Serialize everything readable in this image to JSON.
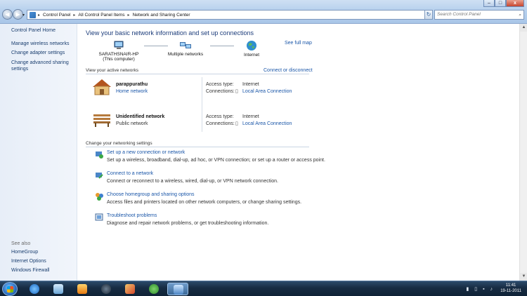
{
  "window": {
    "minimize_label": "–",
    "maximize_label": "□",
    "close_label": "x"
  },
  "address": {
    "crumbs": [
      "Control Panel",
      "All Control Panel Items",
      "Network and Sharing Center"
    ],
    "search_placeholder": "Search Control Panel"
  },
  "sidebar": {
    "home": "Control Panel Home",
    "links": [
      "Manage wireless networks",
      "Change adapter settings",
      "Change advanced sharing settings"
    ],
    "see_also_label": "See also",
    "see_also": [
      "HomeGroup",
      "Internet Options",
      "Windows Firewall"
    ]
  },
  "main": {
    "title": "View your basic network information and set up connections",
    "see_full_map": "See full map",
    "map": {
      "computer_name": "SARATHSNAIR-HP",
      "computer_sub": "(This computer)",
      "multiple": "Multiple networks",
      "internet": "Internet"
    },
    "active_header": "View your active networks",
    "connect_disconnect": "Connect or disconnect",
    "networks": [
      {
        "name": "parappurathu",
        "type": "Home network",
        "access_label": "Access type:",
        "access": "Internet",
        "conn_label": "Connections:",
        "conn": "Local Area Connection"
      },
      {
        "name": "Unidentified network",
        "type": "Public network",
        "access_label": "Access type:",
        "access": "Internet",
        "conn_label": "Connections:",
        "conn": "Local Area Connection"
      }
    ],
    "settings_header": "Change your networking settings",
    "tasks": [
      {
        "title": "Set up a new connection or network",
        "desc": "Set up a wireless, broadband, dial-up, ad hoc, or VPN connection; or set up a router or access point."
      },
      {
        "title": "Connect to a network",
        "desc": "Connect or reconnect to a wireless, wired, dial-up, or VPN network connection."
      },
      {
        "title": "Choose homegroup and sharing options",
        "desc": "Access files and printers located on other network computers, or change sharing settings."
      },
      {
        "title": "Troubleshoot problems",
        "desc": "Diagnose and repair network problems, or get troubleshooting information."
      }
    ]
  },
  "taskbar": {
    "time": "11:41",
    "date": "19-11-2011"
  }
}
